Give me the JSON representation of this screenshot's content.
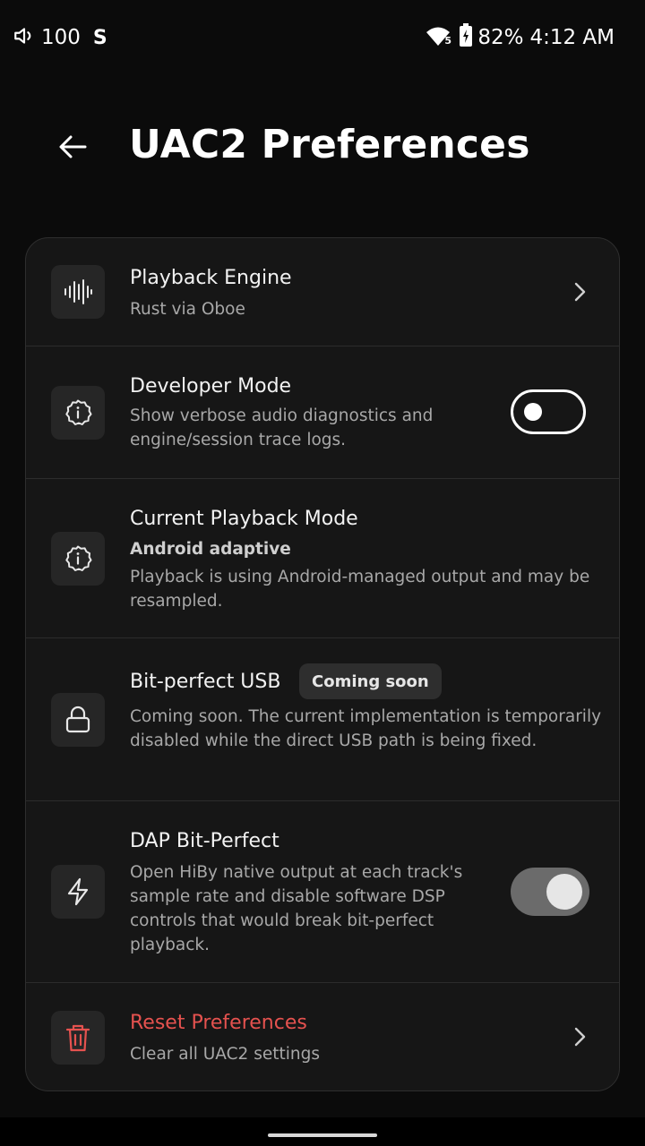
{
  "status_bar": {
    "volume": "100",
    "app_badge": "S",
    "signal_type": "5",
    "battery": "82%",
    "time": "4:12 AM"
  },
  "header": {
    "title": "UAC2 Preferences"
  },
  "settings": {
    "playback_engine": {
      "title": "Playback Engine",
      "subtitle": "Rust via Oboe",
      "icon": "waveform-icon"
    },
    "developer_mode": {
      "title": "Developer Mode",
      "subtitle": "Show verbose audio diagnostics and engine/session trace logs.",
      "icon": "info-icon",
      "enabled": false
    },
    "current_mode": {
      "title": "Current Playback Mode",
      "value": "Android adaptive",
      "subtitle": "Playback is using Android-managed output and may be resampled.",
      "icon": "info-icon"
    },
    "bit_perfect_usb": {
      "title": "Bit-perfect USB",
      "badge": "Coming soon",
      "subtitle": "Coming soon. The current implementation is temporarily disabled while the direct USB path is being fixed.",
      "icon": "lock-icon"
    },
    "dap_bit_perfect": {
      "title": "DAP Bit-Perfect",
      "subtitle": "Open HiBy native output at each track's sample rate and disable software DSP controls that would break bit-perfect playback.",
      "icon": "bolt-icon",
      "enabled": true
    },
    "reset": {
      "title": "Reset Preferences",
      "subtitle": "Clear all UAC2 settings",
      "icon": "trash-icon",
      "color": "#e5524f"
    }
  }
}
